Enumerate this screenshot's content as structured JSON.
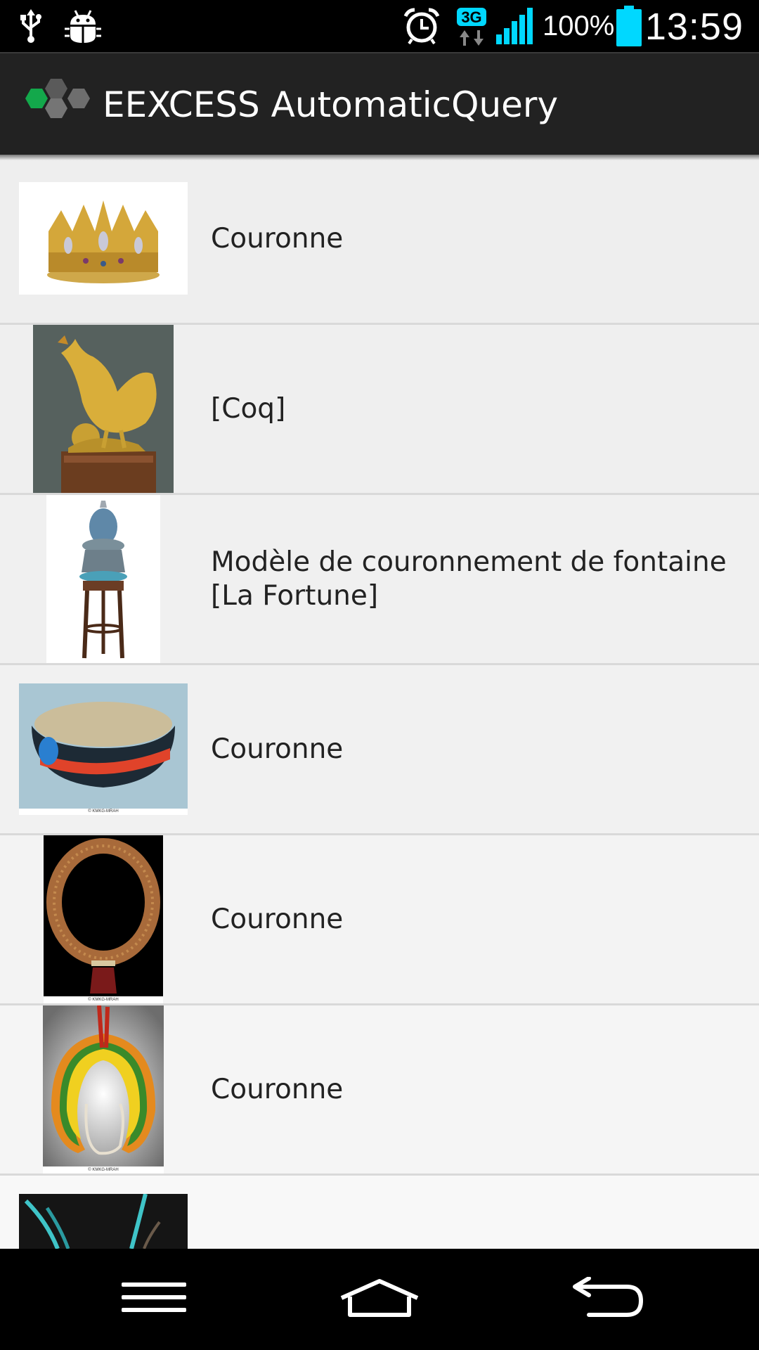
{
  "status_bar": {
    "icons": [
      "usb-icon",
      "android-debug-icon",
      "alarm-icon",
      "3g-data-icon",
      "signal-icon",
      "battery-icon"
    ],
    "network_label": "3G",
    "battery_percent": "100%",
    "time": "13:59",
    "colors": {
      "accent": "#00d8ff"
    }
  },
  "action_bar": {
    "title": "EEXCESS AutomaticQuery",
    "logo_icon": "eexcess-logo",
    "colors": {
      "background": "#222222",
      "logo_green": "#13a84b",
      "logo_gray": "#6e6e6e"
    }
  },
  "results": [
    {
      "title": "Couronne",
      "thumbnail": "gold-crown-image"
    },
    {
      "title": "[Coq]",
      "thumbnail": "gold-rooster-statue-image"
    },
    {
      "title": "Modèle de couronnement de fontaine [La Fortune]",
      "thumbnail": "fountain-model-image"
    },
    {
      "title": "Couronne",
      "thumbnail": "feather-headband-image",
      "caption": "© KMKG-MRAH"
    },
    {
      "title": "Couronne",
      "thumbnail": "woven-necklace-image",
      "caption": "© KMKG-MRAH"
    },
    {
      "title": "Couronne",
      "thumbnail": "feather-headdress-image",
      "caption": "© KMKG-MRAH"
    },
    {
      "title": "",
      "thumbnail": "feathers-image"
    }
  ],
  "nav_bar": {
    "buttons": [
      "menu-icon",
      "home-icon",
      "back-icon"
    ]
  }
}
